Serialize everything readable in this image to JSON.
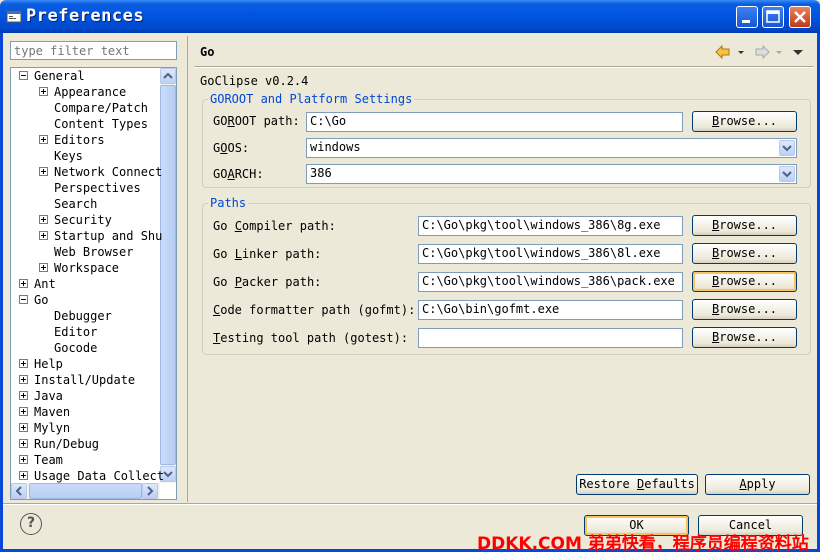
{
  "window": {
    "title": "Preferences"
  },
  "filter": {
    "placeholder": "type filter text"
  },
  "tree": {
    "items": [
      {
        "label": "General",
        "expander": "minus"
      },
      {
        "label": "Appearance",
        "expander": "plus"
      },
      {
        "label": "Compare/Patch",
        "expander": "none"
      },
      {
        "label": "Content Types",
        "expander": "none"
      },
      {
        "label": "Editors",
        "expander": "plus"
      },
      {
        "label": "Keys",
        "expander": "none"
      },
      {
        "label": "Network Connect",
        "expander": "plus"
      },
      {
        "label": "Perspectives",
        "expander": "none"
      },
      {
        "label": "Search",
        "expander": "none"
      },
      {
        "label": "Security",
        "expander": "plus"
      },
      {
        "label": "Startup and Shu",
        "expander": "plus"
      },
      {
        "label": "Web Browser",
        "expander": "none"
      },
      {
        "label": "Workspace",
        "expander": "plus"
      },
      {
        "label": "Ant",
        "expander": "plus"
      },
      {
        "label": "Go",
        "expander": "minus"
      },
      {
        "label": "Debugger",
        "expander": "none"
      },
      {
        "label": "Editor",
        "expander": "none"
      },
      {
        "label": "Gocode",
        "expander": "none"
      },
      {
        "label": "Help",
        "expander": "plus"
      },
      {
        "label": "Install/Update",
        "expander": "plus"
      },
      {
        "label": "Java",
        "expander": "plus"
      },
      {
        "label": "Maven",
        "expander": "plus"
      },
      {
        "label": "Mylyn",
        "expander": "plus"
      },
      {
        "label": "Run/Debug",
        "expander": "plus"
      },
      {
        "label": "Team",
        "expander": "plus"
      },
      {
        "label": "Usage Data Collect",
        "expander": "plus"
      }
    ]
  },
  "page": {
    "title": "Go",
    "version": "GoClipse v0.2.4"
  },
  "goroot_group": {
    "title": "GOROOT and Platform Settings",
    "goroot_label_pre": "GO",
    "goroot_label_u": "R",
    "goroot_label_post": "OOT path:",
    "goroot_value": "C:\\Go",
    "goos_label_pre": "G",
    "goos_label_u": "O",
    "goos_label_post": "OS:",
    "goos_value": "windows",
    "goarch_label_pre": "GO",
    "goarch_label_u": "A",
    "goarch_label_post": "RCH:",
    "goarch_value": "386",
    "browse_pre": "",
    "browse_u": "B",
    "browse_post": "rowse..."
  },
  "paths_group": {
    "title": "Paths",
    "rows": [
      {
        "pre": "Go ",
        "u": "C",
        "post": "ompiler path:",
        "value": "C:\\Go\\pkg\\tool\\windows_386\\8g.exe"
      },
      {
        "pre": "Go ",
        "u": "L",
        "post": "inker path:",
        "value": "C:\\Go\\pkg\\tool\\windows_386\\8l.exe"
      },
      {
        "pre": "Go ",
        "u": "P",
        "post": "acker path:",
        "value": "C:\\Go\\pkg\\tool\\windows_386\\pack.exe"
      },
      {
        "pre": "",
        "u": "C",
        "post": "ode formatter path (gofmt):",
        "value": "C:\\Go\\bin\\gofmt.exe"
      },
      {
        "pre": "",
        "u": "T",
        "post": "esting tool path (gotest):",
        "value": ""
      }
    ]
  },
  "buttons": {
    "restore_pre": "Restore ",
    "restore_u": "D",
    "restore_post": "efaults",
    "apply_u": "A",
    "apply_post": "pply",
    "ok": "OK",
    "cancel": "Cancel"
  },
  "help": {
    "glyph": "?"
  },
  "watermark": {
    "text": "DDKK.COM 弟弟快看，程序员编程资料站"
  }
}
